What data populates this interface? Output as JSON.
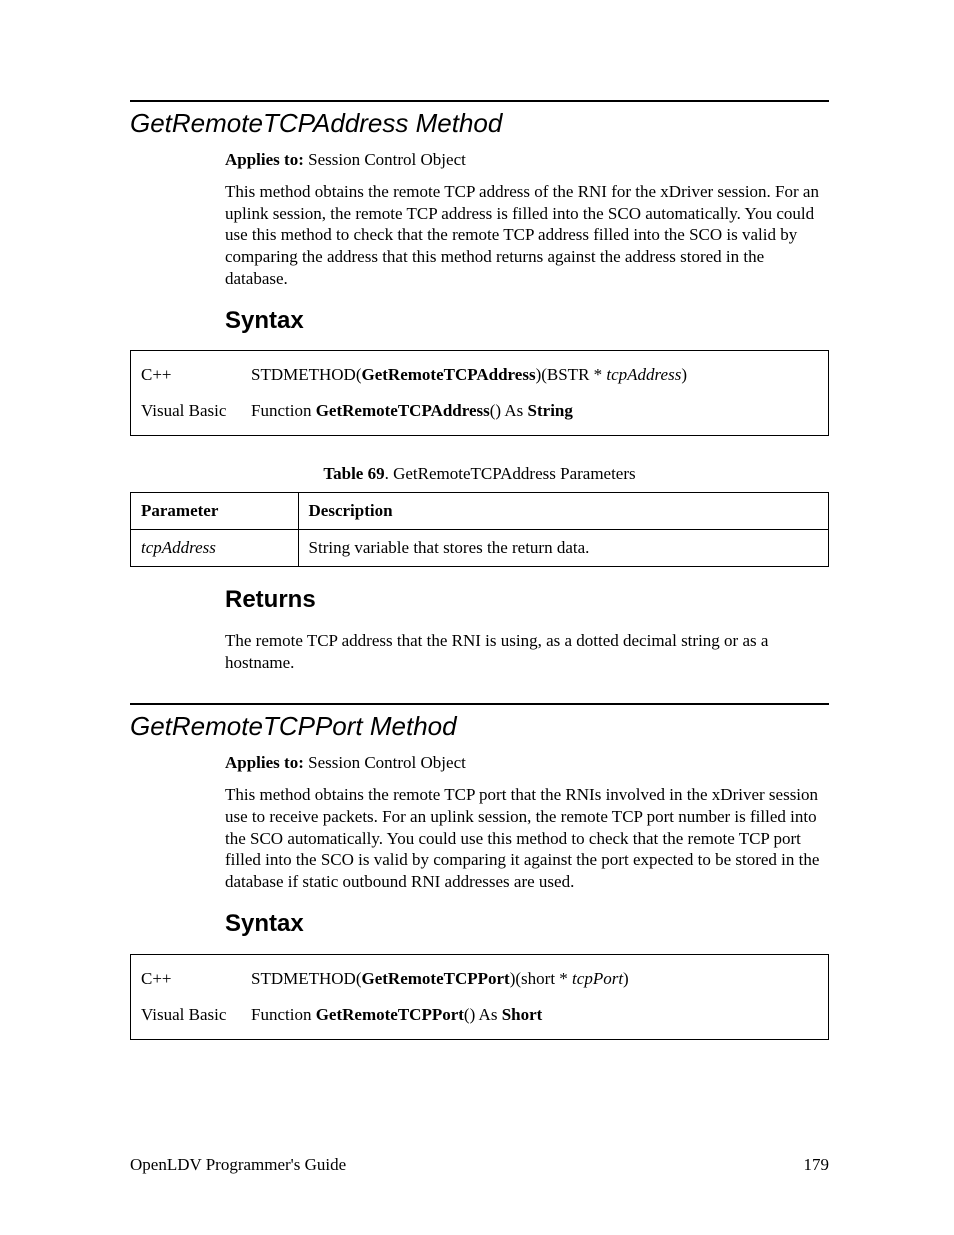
{
  "method1": {
    "title": "GetRemoteTCPAddress Method",
    "applies_label": "Applies to:",
    "applies_value": "Session Control Object",
    "description": "This method obtains the remote TCP address of the RNI for the xDriver session. For an uplink session, the remote TCP address is filled into the SCO automatically.  You could use this method to check that the remote TCP address filled into the SCO is valid by comparing the address that this method returns against the address stored in the database.",
    "syntax_heading": "Syntax",
    "syntax": {
      "cpp": {
        "lang": "C++",
        "prefix": "STDMETHOD(",
        "name": "GetRemoteTCPAddress",
        "mid": ")(BSTR * ",
        "param": "tcpAddress",
        "suffix": ")"
      },
      "vb": {
        "lang": "Visual Basic",
        "prefix": "Function ",
        "name": "GetRemoteTCPAddress",
        "mid": "() As ",
        "ret": "String"
      }
    },
    "table_caption_prefix": "Table 69",
    "table_caption_rest": ". GetRemoteTCPAddress Parameters",
    "param_table": {
      "h1": "Parameter",
      "h2": "Description",
      "rows": [
        {
          "param": "tcpAddress",
          "desc": "String variable that stores the return data."
        }
      ]
    },
    "returns_heading": "Returns",
    "returns_text": "The remote TCP address that the RNI is using, as a dotted decimal string or as a hostname."
  },
  "method2": {
    "title": "GetRemoteTCPPort Method",
    "applies_label": "Applies to:",
    "applies_value": "Session Control Object",
    "description": "This method obtains the remote TCP port that the RNIs involved in the xDriver session use to receive packets.  For an uplink session, the remote TCP port number is filled into the SCO automatically.  You could use this method to check that the remote TCP port filled into the SCO is valid by comparing it against the port expected to be stored in the database if static outbound RNI addresses are used.",
    "syntax_heading": "Syntax",
    "syntax": {
      "cpp": {
        "lang": "C++",
        "prefix": "STDMETHOD(",
        "name": "GetRemoteTCPPort",
        "mid": ")(short * ",
        "param": "tcpPort",
        "suffix": ")"
      },
      "vb": {
        "lang": "Visual Basic",
        "prefix": "Function ",
        "name": "GetRemoteTCPPort",
        "mid": "() As ",
        "ret": "Short"
      }
    }
  },
  "footer": {
    "doc_title": "OpenLDV Programmer's Guide",
    "page_num": "179"
  }
}
